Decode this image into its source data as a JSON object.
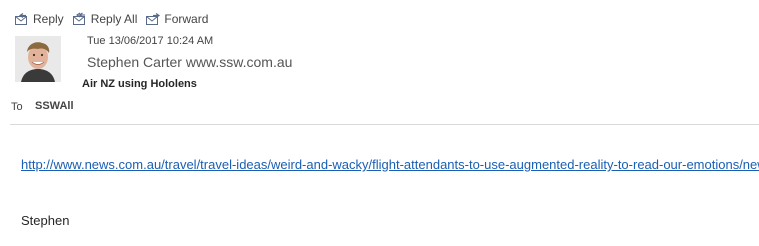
{
  "toolbar": {
    "reply_label": "Reply",
    "reply_all_label": "Reply All",
    "forward_label": "Forward"
  },
  "message": {
    "date": "Tue 13/06/2017 10:24 AM",
    "sender": "Stephen Carter www.ssw.com.au",
    "subject": "Air NZ using Hololens",
    "to_label": "To",
    "to_value": "SSWAll"
  },
  "body": {
    "link": "http://www.news.com.au/travel/travel-ideas/weird-and-wacky/flight-attendants-to-use-augmented-reality-to-read-our-emotions/news-story",
    "signature": "Stephen"
  },
  "colors": {
    "link": "#1a5fb4",
    "divider": "#d9d9d9"
  },
  "icons": {
    "reply": "reply-icon",
    "reply_all": "reply-all-icon",
    "forward": "forward-icon"
  }
}
